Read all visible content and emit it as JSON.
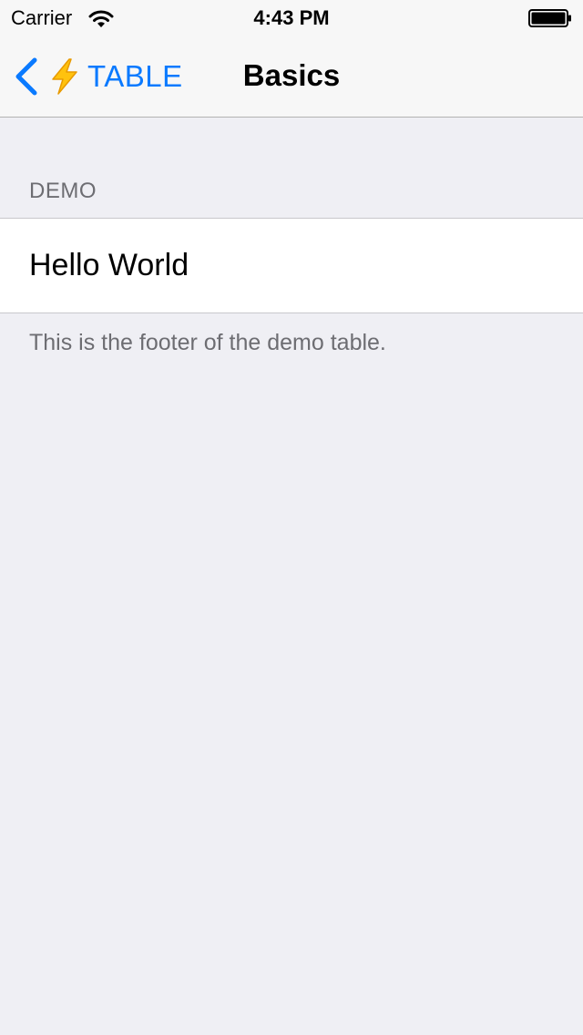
{
  "status_bar": {
    "carrier": "Carrier",
    "time": "4:43 PM"
  },
  "nav": {
    "back_label": "TABLE",
    "title": "Basics",
    "accent_color": "#0a7aff",
    "back_icon": "chevron-left-icon",
    "emoji_icon": "lightning-bolt-icon"
  },
  "table": {
    "section_header": "DEMO",
    "rows": [
      {
        "label": "Hello World"
      }
    ],
    "section_footer": "This is the footer of the demo table."
  }
}
